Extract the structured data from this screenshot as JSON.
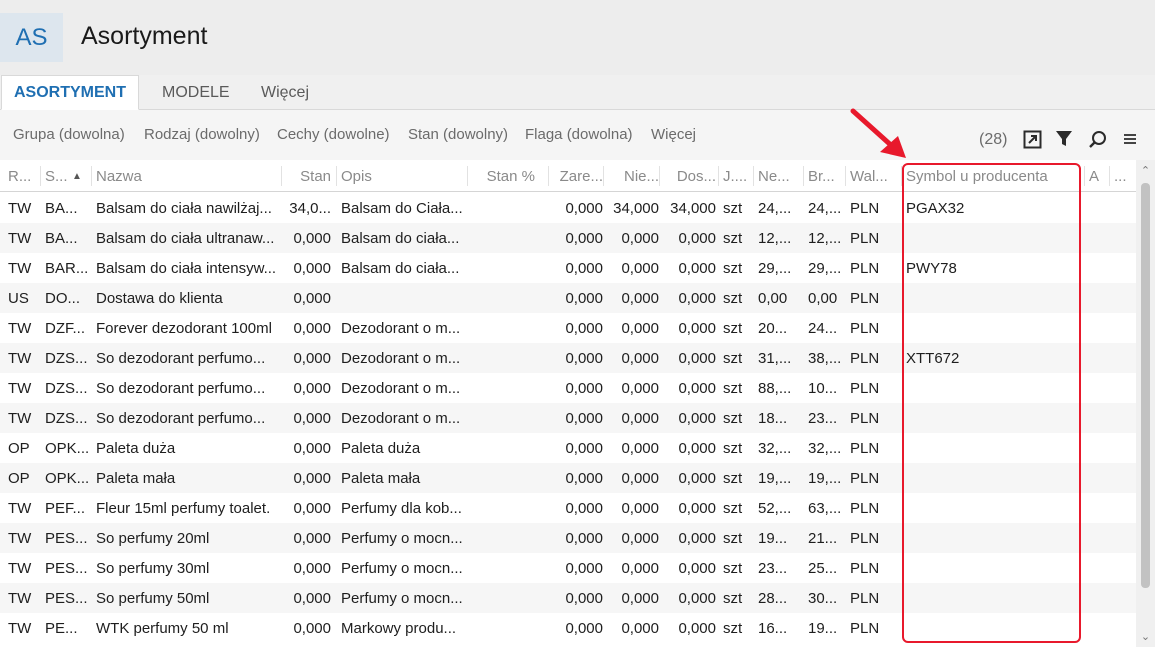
{
  "app": {
    "badge": "AS",
    "title": "Asortyment"
  },
  "tabs": [
    {
      "label": "ASORTYMENT"
    },
    {
      "label": "MODELE"
    },
    {
      "label": "Więcej"
    }
  ],
  "filters": [
    {
      "label": "Grupa (dowolna)"
    },
    {
      "label": "Rodzaj (dowolny)"
    },
    {
      "label": "Cechy (dowolne)"
    },
    {
      "label": "Stan (dowolny)"
    },
    {
      "label": "Flaga (dowolna)"
    },
    {
      "label": "Więcej"
    }
  ],
  "toolbar": {
    "count": "(28)",
    "icons": [
      "export-icon",
      "filter-icon",
      "search-icon",
      "menu-icon"
    ]
  },
  "columns": [
    "R...",
    "S...",
    "Nazwa",
    "Stan",
    "Opis",
    "Stan %",
    "Zare...",
    "Nie...",
    "Dos...",
    "J....",
    "Ne...",
    "Br...",
    "Wal...",
    "Symbol u producenta",
    "A",
    "..."
  ],
  "rows": [
    [
      "TW",
      "BA...",
      "Balsam do ciała nawilżaj...",
      "34,0...",
      "Balsam do Ciała...",
      "",
      "0,000",
      "34,000",
      "34,000",
      "szt",
      "24,...",
      "24,...",
      "PLN",
      "PGAX32",
      ""
    ],
    [
      "TW",
      "BA...",
      "Balsam do ciała ultranaw...",
      "0,000",
      "Balsam do ciała...",
      "",
      "0,000",
      "0,000",
      "0,000",
      "szt",
      "12,...",
      "12,...",
      "PLN",
      "",
      ""
    ],
    [
      "TW",
      "BAR...",
      "Balsam do ciała intensyw...",
      "0,000",
      "Balsam do ciała...",
      "",
      "0,000",
      "0,000",
      "0,000",
      "szt",
      "29,...",
      "29,...",
      "PLN",
      "PWY78",
      ""
    ],
    [
      "US",
      "DO...",
      "Dostawa do klienta",
      "0,000",
      "",
      "",
      "0,000",
      "0,000",
      "0,000",
      "szt",
      "0,00",
      "0,00",
      "PLN",
      "",
      ""
    ],
    [
      "TW",
      "DZF...",
      "Forever dezodorant 100ml",
      "0,000",
      "Dezodorant o m...",
      "",
      "0,000",
      "0,000",
      "0,000",
      "szt",
      "20...",
      "24...",
      "PLN",
      "",
      ""
    ],
    [
      "TW",
      "DZS...",
      "So dezodorant perfumo...",
      "0,000",
      "Dezodorant o m...",
      "",
      "0,000",
      "0,000",
      "0,000",
      "szt",
      "31,...",
      "38,...",
      "PLN",
      "XTT672",
      ""
    ],
    [
      "TW",
      "DZS...",
      "So dezodorant perfumo...",
      "0,000",
      "Dezodorant o m...",
      "",
      "0,000",
      "0,000",
      "0,000",
      "szt",
      "88,...",
      "10...",
      "PLN",
      "",
      ""
    ],
    [
      "TW",
      "DZS...",
      "So dezodorant perfumo...",
      "0,000",
      "Dezodorant o m...",
      "",
      "0,000",
      "0,000",
      "0,000",
      "szt",
      "18...",
      "23...",
      "PLN",
      "",
      ""
    ],
    [
      "OP",
      "OPK...",
      "Paleta duża",
      "0,000",
      "Paleta duża",
      "",
      "0,000",
      "0,000",
      "0,000",
      "szt",
      "32,...",
      "32,...",
      "PLN",
      "",
      ""
    ],
    [
      "OP",
      "OPK...",
      "Paleta mała",
      "0,000",
      "Paleta mała",
      "",
      "0,000",
      "0,000",
      "0,000",
      "szt",
      "19,...",
      "19,...",
      "PLN",
      "",
      ""
    ],
    [
      "TW",
      "PEF...",
      "Fleur 15ml perfumy toalet.",
      "0,000",
      "Perfumy dla kob...",
      "",
      "0,000",
      "0,000",
      "0,000",
      "szt",
      "52,...",
      "63,...",
      "PLN",
      "",
      ""
    ],
    [
      "TW",
      "PES...",
      "So perfumy 20ml",
      "0,000",
      "Perfumy o mocn...",
      "",
      "0,000",
      "0,000",
      "0,000",
      "szt",
      "19...",
      "21...",
      "PLN",
      "",
      ""
    ],
    [
      "TW",
      "PES...",
      "So perfumy 30ml",
      "0,000",
      "Perfumy o mocn...",
      "",
      "0,000",
      "0,000",
      "0,000",
      "szt",
      "23...",
      "25...",
      "PLN",
      "",
      ""
    ],
    [
      "TW",
      "PES...",
      "So perfumy 50ml",
      "0,000",
      "Perfumy o mocn...",
      "",
      "0,000",
      "0,000",
      "0,000",
      "szt",
      "28...",
      "30...",
      "PLN",
      "",
      ""
    ],
    [
      "TW",
      "PE...",
      "WTK perfumy 50 ml",
      "0,000",
      "Markowy produ...",
      "",
      "0,000",
      "0,000",
      "0,000",
      "szt",
      "16...",
      "19...",
      "PLN",
      "",
      ""
    ]
  ],
  "colors": {
    "accent": "#1f6fb2",
    "highlight": "#e8192c"
  }
}
